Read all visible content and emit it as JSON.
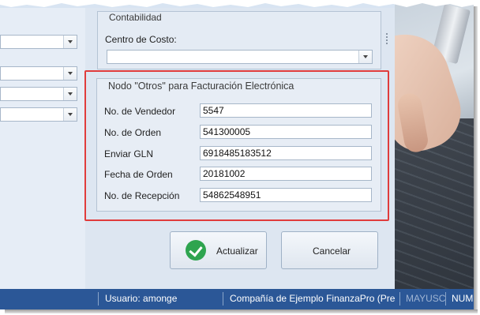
{
  "conta": {
    "group_title": "Contabilidad",
    "centro_label": "Centro de Costo:",
    "centro_value": ""
  },
  "otros": {
    "group_title": "Nodo \"Otros\" para Facturación Electrónica",
    "fields": [
      {
        "label": "No. de Vendedor",
        "value": "5547"
      },
      {
        "label": "No. de Orden",
        "value": "541300005"
      },
      {
        "label": "Enviar GLN",
        "value": "6918485183512"
      },
      {
        "label": "Fecha de Orden",
        "value": "20181002"
      },
      {
        "label": "No. de Recepción",
        "value": "54862548951"
      }
    ]
  },
  "buttons": {
    "update_label": "Actualizar",
    "cancel_label": "Cancelar"
  },
  "status": {
    "user": "Usuario: amonge",
    "company": "Compañía de Ejemplo FinanzaPro (Presenta",
    "caps": "MAYUSC",
    "num": "NUM"
  },
  "colors": {
    "highlight": "#e03c3c",
    "statusbar": "#2b5797",
    "ok": "#2ea44f"
  },
  "icons": {
    "update": "checkmark-circle-icon",
    "dropdown": "chevron-down-icon"
  }
}
